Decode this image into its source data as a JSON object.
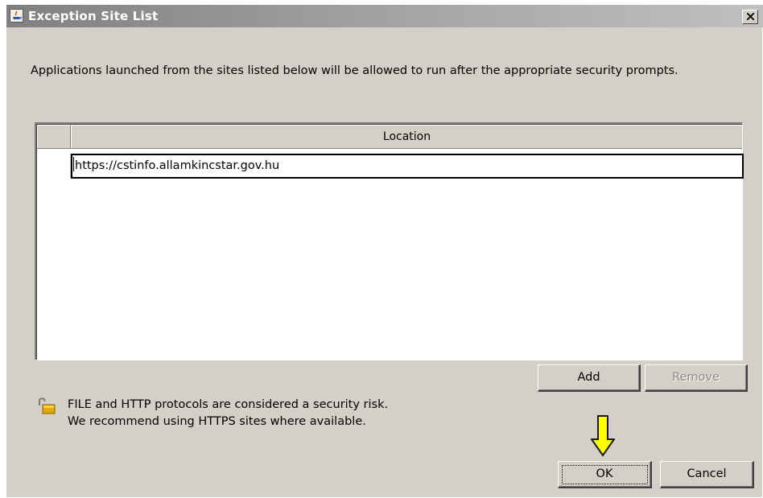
{
  "window": {
    "title": "Exception Site List",
    "close_glyph": "×",
    "icon": "java-icon"
  },
  "description": "Applications launched from the sites listed below will be allowed to run after the appropriate security prompts.",
  "table": {
    "column_header": "Location",
    "rows": [
      {
        "location": "https://cstinfo.allamkincstar.gov.hu"
      }
    ]
  },
  "buttons": {
    "add": "Add",
    "remove": "Remove",
    "ok": "OK",
    "cancel": "Cancel"
  },
  "notice": {
    "icon": "unlocked-padlock-icon",
    "line1": "FILE and HTTP protocols are considered a security risk.",
    "line2": "We recommend using HTTPS sites where available."
  },
  "annotation": {
    "icon": "down-arrow-icon",
    "color": "#ffff00"
  }
}
